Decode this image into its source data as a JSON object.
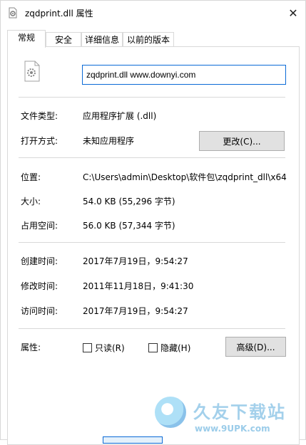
{
  "window": {
    "title": "zqdprint.dll 属性",
    "close_symbol": "✕"
  },
  "tabs": [
    {
      "label": "常规",
      "active": true
    },
    {
      "label": "安全",
      "active": false
    },
    {
      "label": "详细信息",
      "active": false
    },
    {
      "label": "以前的版本",
      "active": false
    }
  ],
  "file": {
    "name": "zqdprint.dll www.downyi.com",
    "icon": "dll-file-icon"
  },
  "props": {
    "type_label": "文件类型:",
    "type_value": "应用程序扩展 (.dll)",
    "open_label": "打开方式:",
    "open_value": "未知应用程序",
    "change_button": "更改(C)...",
    "location_label": "位置:",
    "location_value": "C:\\Users\\admin\\Desktop\\软件包\\zqdprint_dll\\x64",
    "size_label": "大小:",
    "size_value": "54.0 KB (55,296 字节)",
    "disk_label": "占用空间:",
    "disk_value": "56.0 KB (57,344 字节)",
    "created_label": "创建时间:",
    "created_value": "2017年7月19日，9:54:27",
    "modified_label": "修改时间:",
    "modified_value": "2011年11月18日，9:41:30",
    "accessed_label": "访问时间:",
    "accessed_value": "2017年7月19日，9:54:27",
    "attr_label": "属性:",
    "readonly_label": "只读(R)",
    "hidden_label": "隐藏(H)",
    "advanced_button": "高级(D)..."
  },
  "watermark": {
    "title": "久友下载站",
    "url": "www.9UPK.com"
  }
}
